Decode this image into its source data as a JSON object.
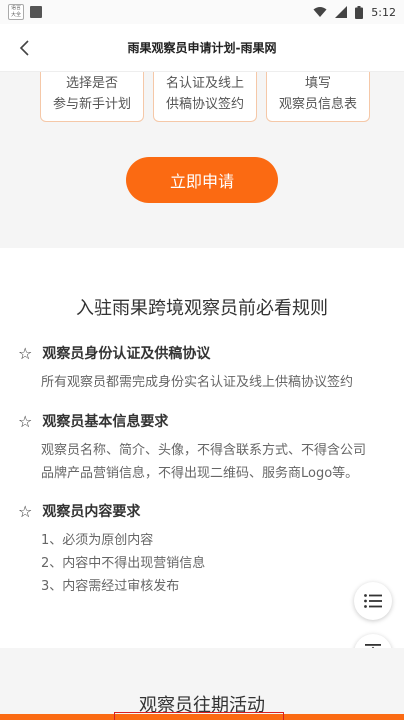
{
  "status_bar": {
    "time": "5:12",
    "app_icon_text": "语言\n大全"
  },
  "nav": {
    "title": "雨果观察员申请计划-雨果网"
  },
  "steps": [
    {
      "label": "选择是否\n参与新手计划"
    },
    {
      "label": "名认证及线上\n供稿协议签约"
    },
    {
      "label": "填写\n观察员信息表"
    }
  ],
  "apply_button": "立即申请",
  "rules": {
    "title": "入驻雨果跨境观察员前必看规则",
    "items": [
      {
        "heading": "观察员身份认证及供稿协议",
        "lines": [
          "所有观察员都需完成身份实名认证及线上供稿协议签约"
        ]
      },
      {
        "heading": "观察员基本信息要求",
        "lines": [
          "观察员名称、简介、头像，不得含联系方式、不得含公司",
          "品牌产品营销信息，不得出现二维码、服务商Logo等。"
        ]
      },
      {
        "heading": "观察员内容要求",
        "lines": [
          "1、必须为原创内容",
          "2、内容中不得出现营销信息",
          "3、内容需经过审核发布"
        ]
      }
    ]
  },
  "activities_title": "观察员往期活动",
  "colors": {
    "accent": "#fb6a12",
    "card_border": "#f5c8a8",
    "section_bg": "#f5f5f5"
  }
}
